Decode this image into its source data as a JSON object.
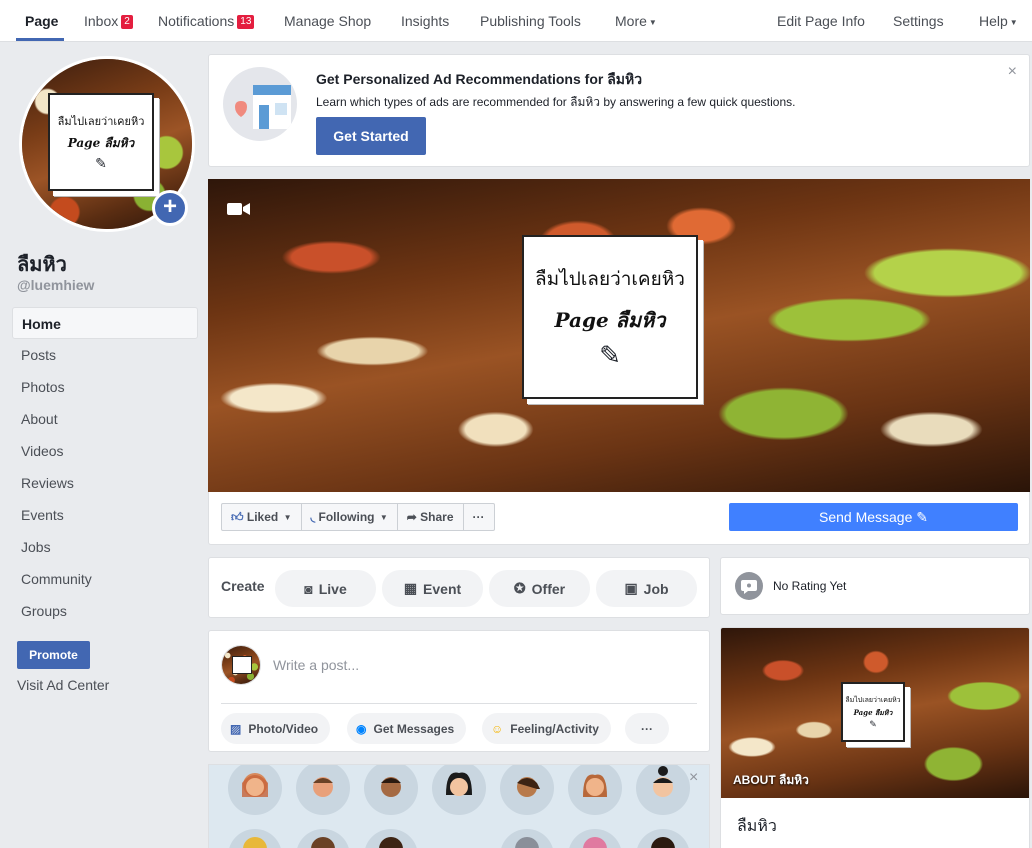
{
  "nav": {
    "page": "Page",
    "inbox": "Inbox",
    "inbox_badge": "2",
    "notifications": "Notifications",
    "notifications_badge": "13",
    "manage_shop": "Manage Shop",
    "insights": "Insights",
    "publishing_tools": "Publishing Tools",
    "more": "More",
    "edit_page_info": "Edit Page Info",
    "settings": "Settings",
    "help": "Help"
  },
  "logo": {
    "line1": "ลืมไปเลยว่าเคยหิว",
    "line2": "Page ลืมหิว"
  },
  "profile": {
    "name": "ลืมหิว",
    "handle": "@luemhiew"
  },
  "sidebar": {
    "items": [
      "Home",
      "Posts",
      "Photos",
      "About",
      "Videos",
      "Reviews",
      "Events",
      "Jobs",
      "Community",
      "Groups"
    ],
    "promote": "Promote",
    "visit_ad_center": "Visit Ad Center"
  },
  "ad_rec": {
    "title": "Get Personalized Ad Recommendations for ลืมหิว",
    "subtitle": "Learn which types of ads are recommended for ลืมหิว by answering a few quick questions.",
    "button": "Get Started",
    "close": "×"
  },
  "actions": {
    "liked": "Liked",
    "following": "Following",
    "share": "Share",
    "more": "···",
    "send_message": "Send Message"
  },
  "create": {
    "label": "Create",
    "live": "Live",
    "event": "Event",
    "offer": "Offer",
    "job": "Job"
  },
  "composer": {
    "placeholder": "Write a post...",
    "photo_video": "Photo/Video",
    "get_messages": "Get Messages",
    "feeling": "Feeling/Activity",
    "more": "···"
  },
  "invite": {
    "close": "×"
  },
  "rating": {
    "text": "No Rating Yet"
  },
  "about": {
    "label": "ABOUT ลืมหิว",
    "name": "ลืมหิว"
  },
  "colors": {
    "brand": "#4267b2",
    "send_message": "#4080ff",
    "badge": "#e41e3f"
  }
}
